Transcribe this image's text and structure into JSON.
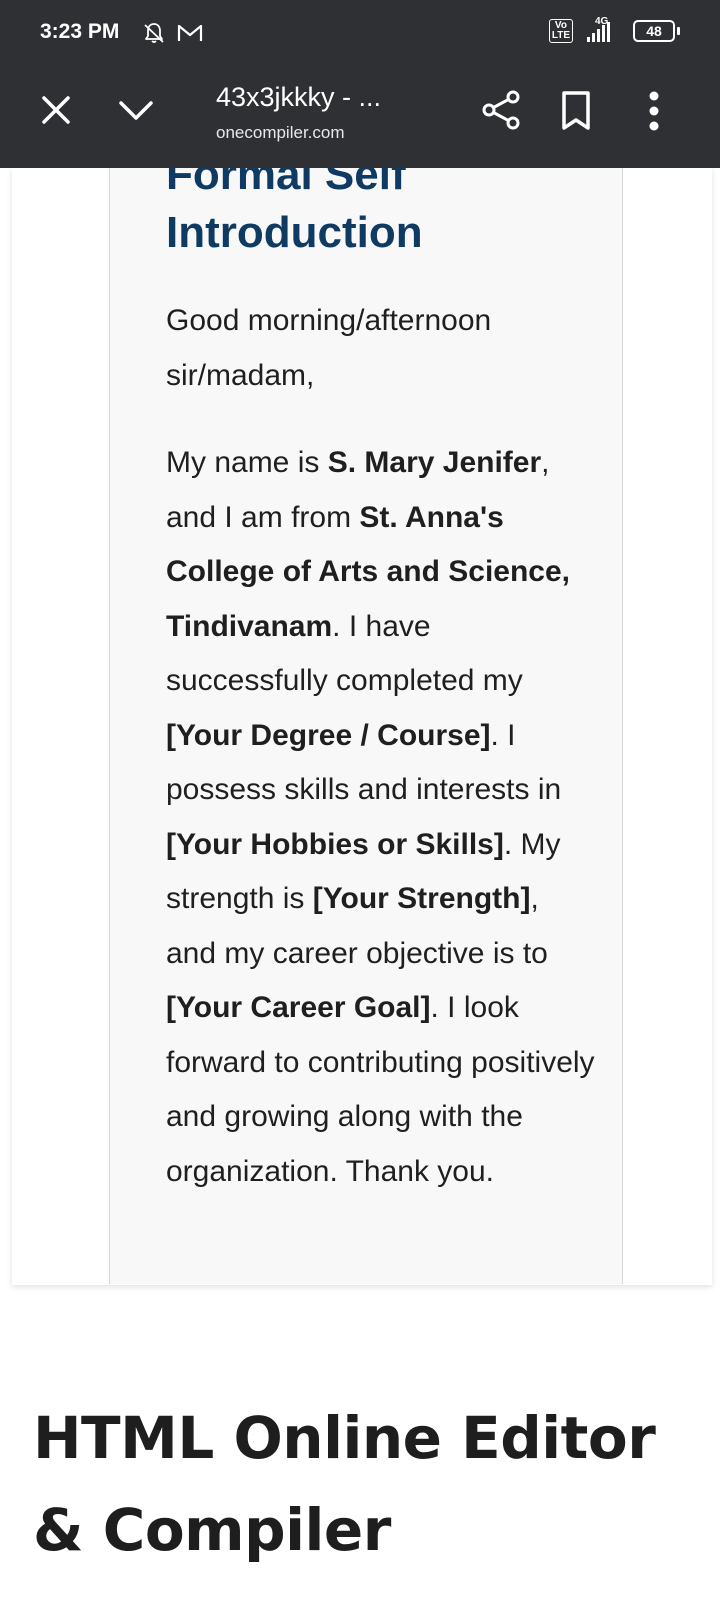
{
  "status_bar": {
    "time": "3:23 PM",
    "network_type": "4G",
    "volte_top": "Vo",
    "volte_bottom": "LTE",
    "battery": "48",
    "icons": [
      "notifications-off-icon",
      "gmail-icon",
      "volte-icon",
      "signal-icon",
      "battery-icon"
    ]
  },
  "toolbar": {
    "title": "43x3jkkky - ...",
    "domain": "onecompiler.com",
    "icons": [
      "close-icon",
      "chevron-down-icon",
      "share-icon",
      "bookmark-icon",
      "more-vert-icon"
    ]
  },
  "page": {
    "card": {
      "heading_partial": "Formal Self",
      "heading": "Introduction",
      "greeting": "Good morning/afternoon sir/madam,",
      "paragraph": {
        "s1": "My name is ",
        "name": "S. Mary Jenifer",
        "s2": ", and I am from ",
        "college": "St. Anna's College of Arts and Science, Tindivanam",
        "s3": ". I have successfully completed my ",
        "degree": "[Your Degree / Course]",
        "s4": ". I possess skills and interests in ",
        "hobbies": "[Your Hobbies or Skills]",
        "s5": ". My strength is ",
        "strength": "[Your Strength]",
        "s6": ", and my career objective is to ",
        "goal": "[Your Career Goal]",
        "s7": ". I look forward to contributing positively and growing along with the organization. Thank you."
      }
    },
    "section_heading": "HTML Online Editor & Compiler"
  },
  "colors": {
    "toolbar_bg": "#2e3033",
    "heading_blue": "#0f3b63",
    "card_bg": "#f8f8f8",
    "text": "#1f1f1f"
  }
}
